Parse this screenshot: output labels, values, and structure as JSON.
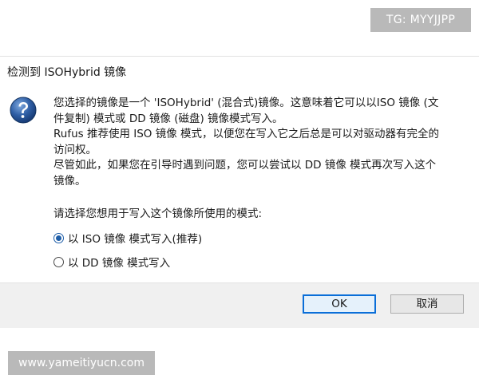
{
  "watermarks": {
    "top_right": "TG: MYYJJPP",
    "bottom_left": "www.yameitiyucn.com"
  },
  "dialog": {
    "title": "检测到 ISOHybrid 镜像",
    "icon": "question-icon",
    "message_lines": [
      "您选择的镜像是一个 'ISOHybrid' (混合式)镜像。这意味着它可以以ISO 镜像 (文",
      "件复制) 模式或 DD 镜像 (磁盘) 镜像模式写入。",
      "Rufus 推荐使用 ISO 镜像 模式，以便您在写入它之后总是可以对驱动器有完全的",
      "访问权。",
      "尽管如此，如果您在引导时遇到问题，您可以尝试以 DD 镜像 模式再次写入这个",
      "镜像。"
    ],
    "prompt": "请选择您想用于写入这个镜像所使用的模式:",
    "options": [
      {
        "label": "以 ISO 镜像 模式写入(推荐)",
        "selected": true
      },
      {
        "label": "以 DD 镜像 模式写入",
        "selected": false
      }
    ],
    "buttons": {
      "ok": "OK",
      "cancel": "取消"
    }
  },
  "colors": {
    "accent": "#1f5ea8",
    "focus_border": "#0a6ed8",
    "button_bar": "#f0f0f0",
    "watermark": "#b9b9b9"
  }
}
